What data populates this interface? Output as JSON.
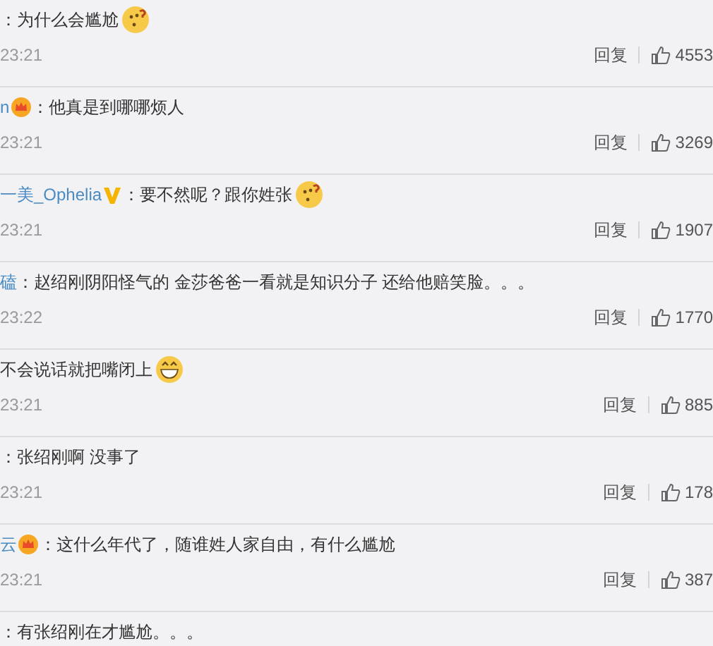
{
  "comments": [
    {
      "text": "：为什么会尴尬",
      "emoji": {
        "kind": "thinking"
      },
      "time": "23:21",
      "reply": "回复",
      "likes": "4553"
    },
    {
      "name": "n",
      "badge": {
        "kind": "crown"
      },
      "text": "：他真是到哪哪烦人",
      "time": "23:21",
      "reply": "回复",
      "likes": "3269"
    },
    {
      "name": "一美_Ophelia",
      "badge": {
        "kind": "vip"
      },
      "text": "：要不然呢？跟你姓张",
      "emoji": {
        "kind": "thinking"
      },
      "time": "23:21",
      "reply": "回复",
      "likes": "1907"
    },
    {
      "name": "磕",
      "text": "：赵绍刚阴阳怪气的 金莎爸爸一看就是知识分子 还给他赔笑脸。。。",
      "time": "23:22",
      "reply": "回复",
      "likes": "1770"
    },
    {
      "text": "不会说话就把嘴闭上",
      "emoji": {
        "kind": "grin"
      },
      "time": "23:21",
      "reply": "回复",
      "likes": "885"
    },
    {
      "text": "：张绍刚啊 没事了",
      "time": "23:21",
      "reply": "回复",
      "likes": "178"
    },
    {
      "name": "云",
      "badge": {
        "kind": "crown"
      },
      "text": "：这什么年代了，随谁姓人家自由，有什么尴尬",
      "time": "23:21",
      "reply": "回复",
      "likes": "387"
    },
    {
      "text": "：有张绍刚在才尴尬。。。"
    }
  ]
}
